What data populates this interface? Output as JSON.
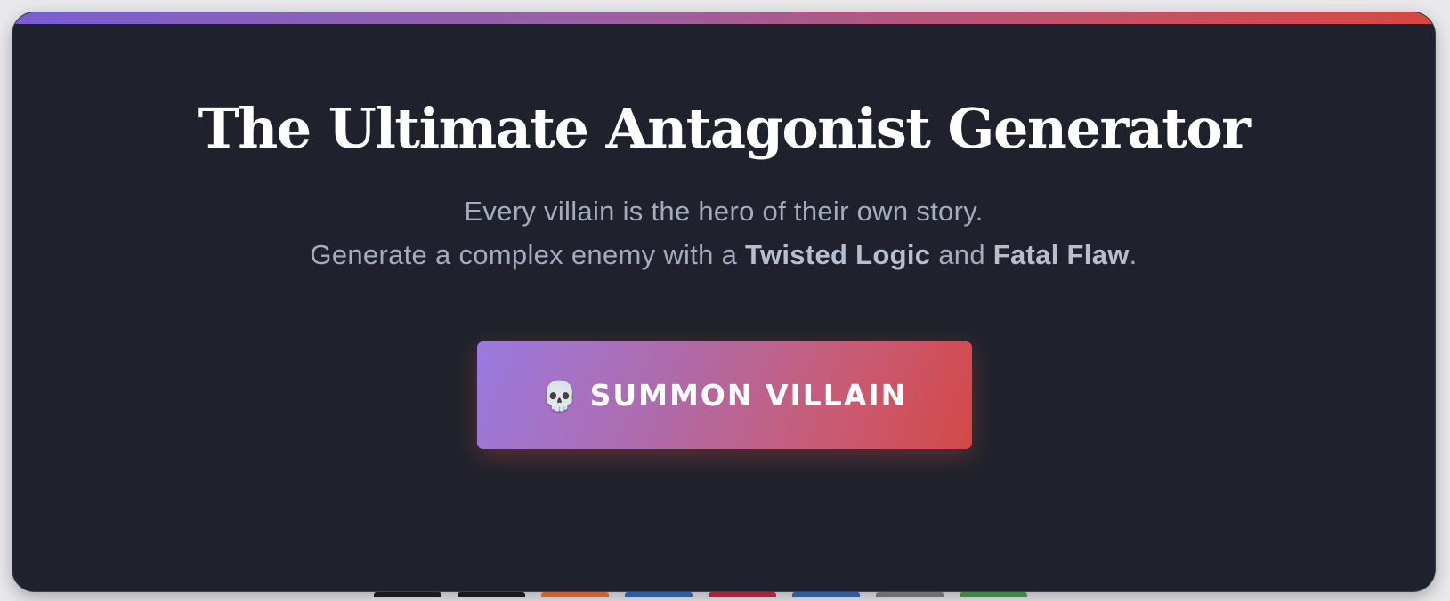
{
  "header": {
    "title": "The Ultimate Antagonist Generator",
    "subtitle_line1": "Every villain is the hero of their own story.",
    "subtitle_line2": {
      "prefix": "Generate a complex enemy with a ",
      "emphasis1": "Twisted Logic",
      "connector": " and ",
      "emphasis2": "Fatal Flaw",
      "suffix": "."
    }
  },
  "summon_button": {
    "icon": "skull-icon",
    "icon_glyph": "💀",
    "label": "SUMMON VILLAIN"
  },
  "colors": {
    "background": "#1f222c",
    "accent_start": "#7a5fd2",
    "accent_end": "#d9473e",
    "title_text": "#ffffff",
    "subtitle_text": "#a3abbd"
  }
}
